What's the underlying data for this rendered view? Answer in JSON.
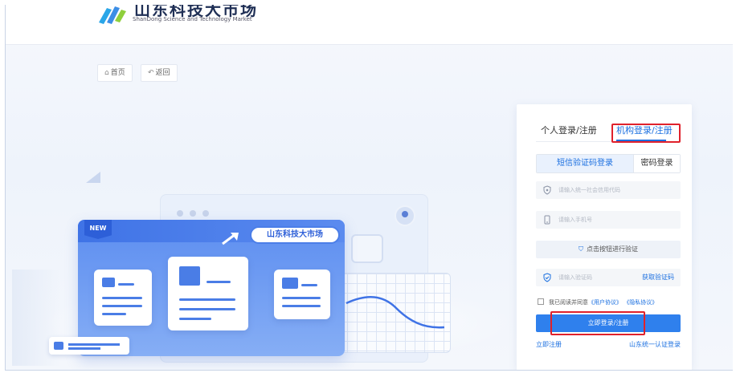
{
  "brand": {
    "name_cn": "山东科技大市场",
    "name_en": "ShanDong Science and Technology Market"
  },
  "nav": {
    "home_label": "首页",
    "back_label": "返回"
  },
  "illustration": {
    "new_badge": "NEW",
    "pill_text": "山东科技大市场"
  },
  "login": {
    "tabs": [
      {
        "label": "个人登录/注册",
        "active": false
      },
      {
        "label": "机构登录/注册",
        "active": true
      }
    ],
    "methods": [
      {
        "label": "短信验证码登录",
        "active": true
      },
      {
        "label": "密码登录",
        "active": false
      }
    ],
    "credit_code_placeholder": "请输入统一社会信用代码",
    "phone_placeholder": "请输入手机号",
    "verify_button": "点击按钮进行验证",
    "code_placeholder": "请输入验证码",
    "get_code_label": "获取验证码",
    "agree_prefix": "我已阅读并同意",
    "user_agreement": "《用户协议》",
    "privacy_policy": "《隐私协议》",
    "submit_label": "立即登录/注册",
    "register_link": "立即注册",
    "unified_login_link": "山东统一认证登录"
  },
  "colors": {
    "accent": "#1a6fe0",
    "button": "#2f80ed",
    "highlight": "#e0212b"
  }
}
